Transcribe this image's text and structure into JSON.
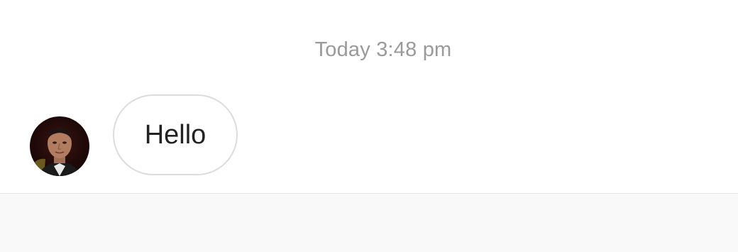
{
  "conversation": {
    "timestamp": "Today 3:48 pm",
    "messages": [
      {
        "direction": "incoming",
        "text": "Hello",
        "avatar": "sender-avatar"
      }
    ]
  },
  "colors": {
    "background": "#ffffff",
    "timestamp_text": "#9a9a9a",
    "bubble_border": "#dcdcdc",
    "bubble_text": "#222222",
    "composer_background": "#f9f9f9",
    "divider": "#e2e2e2"
  }
}
